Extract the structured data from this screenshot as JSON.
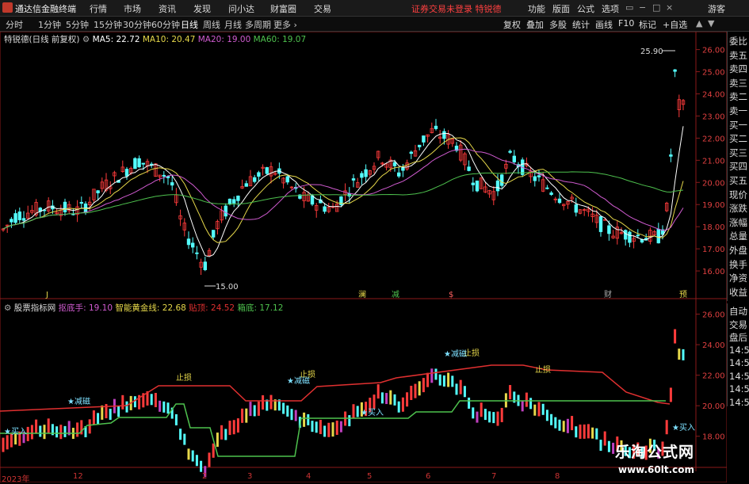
{
  "app": {
    "name": "通达信金融终端",
    "menu": [
      "行情",
      "市场",
      "资讯",
      "发现",
      "问小达",
      "财富圈",
      "交易"
    ],
    "broker_warning": "证券交易未登录",
    "broker_name": "特锐德",
    "right_menu": [
      "功能",
      "版面",
      "公式",
      "选项"
    ],
    "user": "游客",
    "window_controls": [
      "▭",
      "−",
      "□",
      "×"
    ]
  },
  "periods": {
    "items": [
      "分时",
      "1分钟",
      "5分钟",
      "15分钟",
      "30分钟",
      "60分钟",
      "日线",
      "周线",
      "月线",
      "多周期",
      "更多"
    ],
    "active": "日线"
  },
  "toolbar": [
    "复权",
    "叠加",
    "多股",
    "统计",
    "画线",
    "F10",
    "标记",
    "+自选"
  ],
  "main_chart": {
    "title": "特锐德(日线 前复权)",
    "ma": [
      {
        "label": "MA5: 22.72",
        "color": "#ffffff"
      },
      {
        "label": "MA10: 20.47",
        "color": "#e6d84a"
      },
      {
        "label": "MA20: 19.00",
        "color": "#d05bd0"
      },
      {
        "label": "MA60: 19.07",
        "color": "#4ec24e"
      }
    ],
    "high_label": "25.90",
    "low_label": "15.00",
    "price_ticks": [
      "26.00",
      "25.00",
      "24.00",
      "23.00",
      "22.00",
      "21.00",
      "20.00",
      "19.00",
      "18.00",
      "17.00",
      "16.00"
    ],
    "event_markers": [
      "J",
      "澜",
      "减",
      "$",
      "财",
      "预"
    ]
  },
  "sub_chart": {
    "title": "股票指标网",
    "lines": [
      {
        "label": "抠底手: 19.10",
        "color": "#d05bd0"
      },
      {
        "label": "智能黄金线: 22.68",
        "color": "#e6d84a"
      },
      {
        "label": "贴顶: 24.52",
        "color": "#e03030"
      },
      {
        "label": "箱底: 17.12",
        "color": "#4ec24e"
      }
    ],
    "price_ticks": [
      "26.00",
      "24.00",
      "22.00",
      "20.00",
      "18.00"
    ],
    "annotations": [
      "止损",
      "止损",
      "止损",
      "止损",
      "减磁",
      "买入",
      "买入",
      "买入",
      "减磁",
      "减磁"
    ]
  },
  "right_panel": {
    "items": [
      "委比",
      "卖五",
      "卖四",
      "卖三",
      "卖二",
      "卖一",
      "买一",
      "买二",
      "买三",
      "买四",
      "买五",
      "现价",
      "涨跌",
      "涨幅",
      "总量",
      "外盘",
      "换手",
      "净资",
      "收益"
    ],
    "items2": [
      "自动",
      "交易",
      "盘后",
      "14:59",
      "14:59",
      "14:59",
      "14:59",
      "14:59"
    ]
  },
  "x_axis": [
    "2023年",
    "12",
    "2",
    "3",
    "4",
    "5",
    "6",
    "7",
    "8"
  ],
  "watermark": {
    "title": "乐淘公式网",
    "url": "www.60lt.com"
  },
  "chart_data": {
    "type": "candlestick",
    "title": "特锐德(日线 前复权)",
    "x": [
      "2023年",
      "12",
      "2",
      "3",
      "4",
      "5",
      "6",
      "7",
      "8"
    ],
    "ylim": [
      15.0,
      26.2
    ],
    "series": [
      {
        "name": "MA5",
        "last": 22.72
      },
      {
        "name": "MA10",
        "last": 20.47
      },
      {
        "name": "MA20",
        "last": 19.0
      },
      {
        "name": "MA60",
        "last": 19.07
      }
    ],
    "annotations": [
      {
        "label": "25.90",
        "kind": "high"
      },
      {
        "label": "15.00",
        "kind": "low"
      }
    ]
  }
}
